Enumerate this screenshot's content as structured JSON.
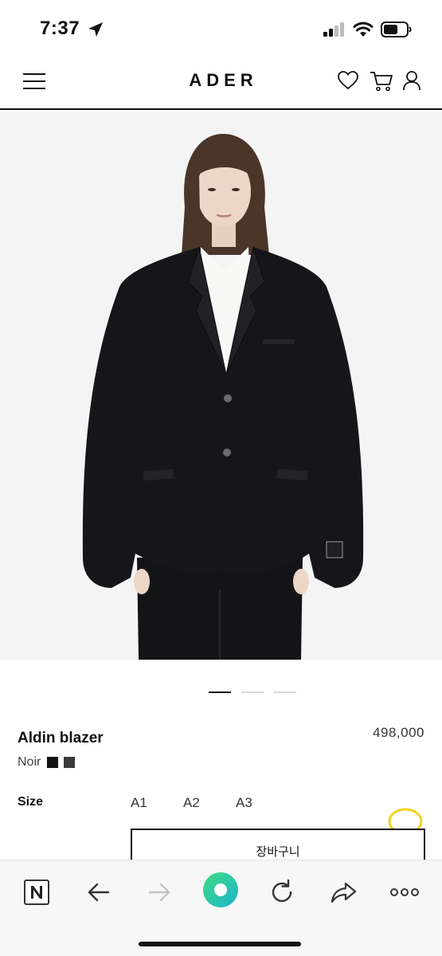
{
  "status": {
    "time": "7:37"
  },
  "header": {
    "brand": "ADER"
  },
  "carousel": {
    "total": 3,
    "active_index": 1
  },
  "product": {
    "name": "Aldin blazer",
    "price": "498,000",
    "color_label": "Noir",
    "swatches": [
      "#111111",
      "#3a3a3a"
    ],
    "size_label": "Size",
    "sizes": [
      "A1",
      "A2",
      "A3"
    ],
    "cart_button": "장바구니"
  },
  "colors": {
    "accent_chat": "#f2d31c",
    "nav_green": "#2fd18c"
  }
}
